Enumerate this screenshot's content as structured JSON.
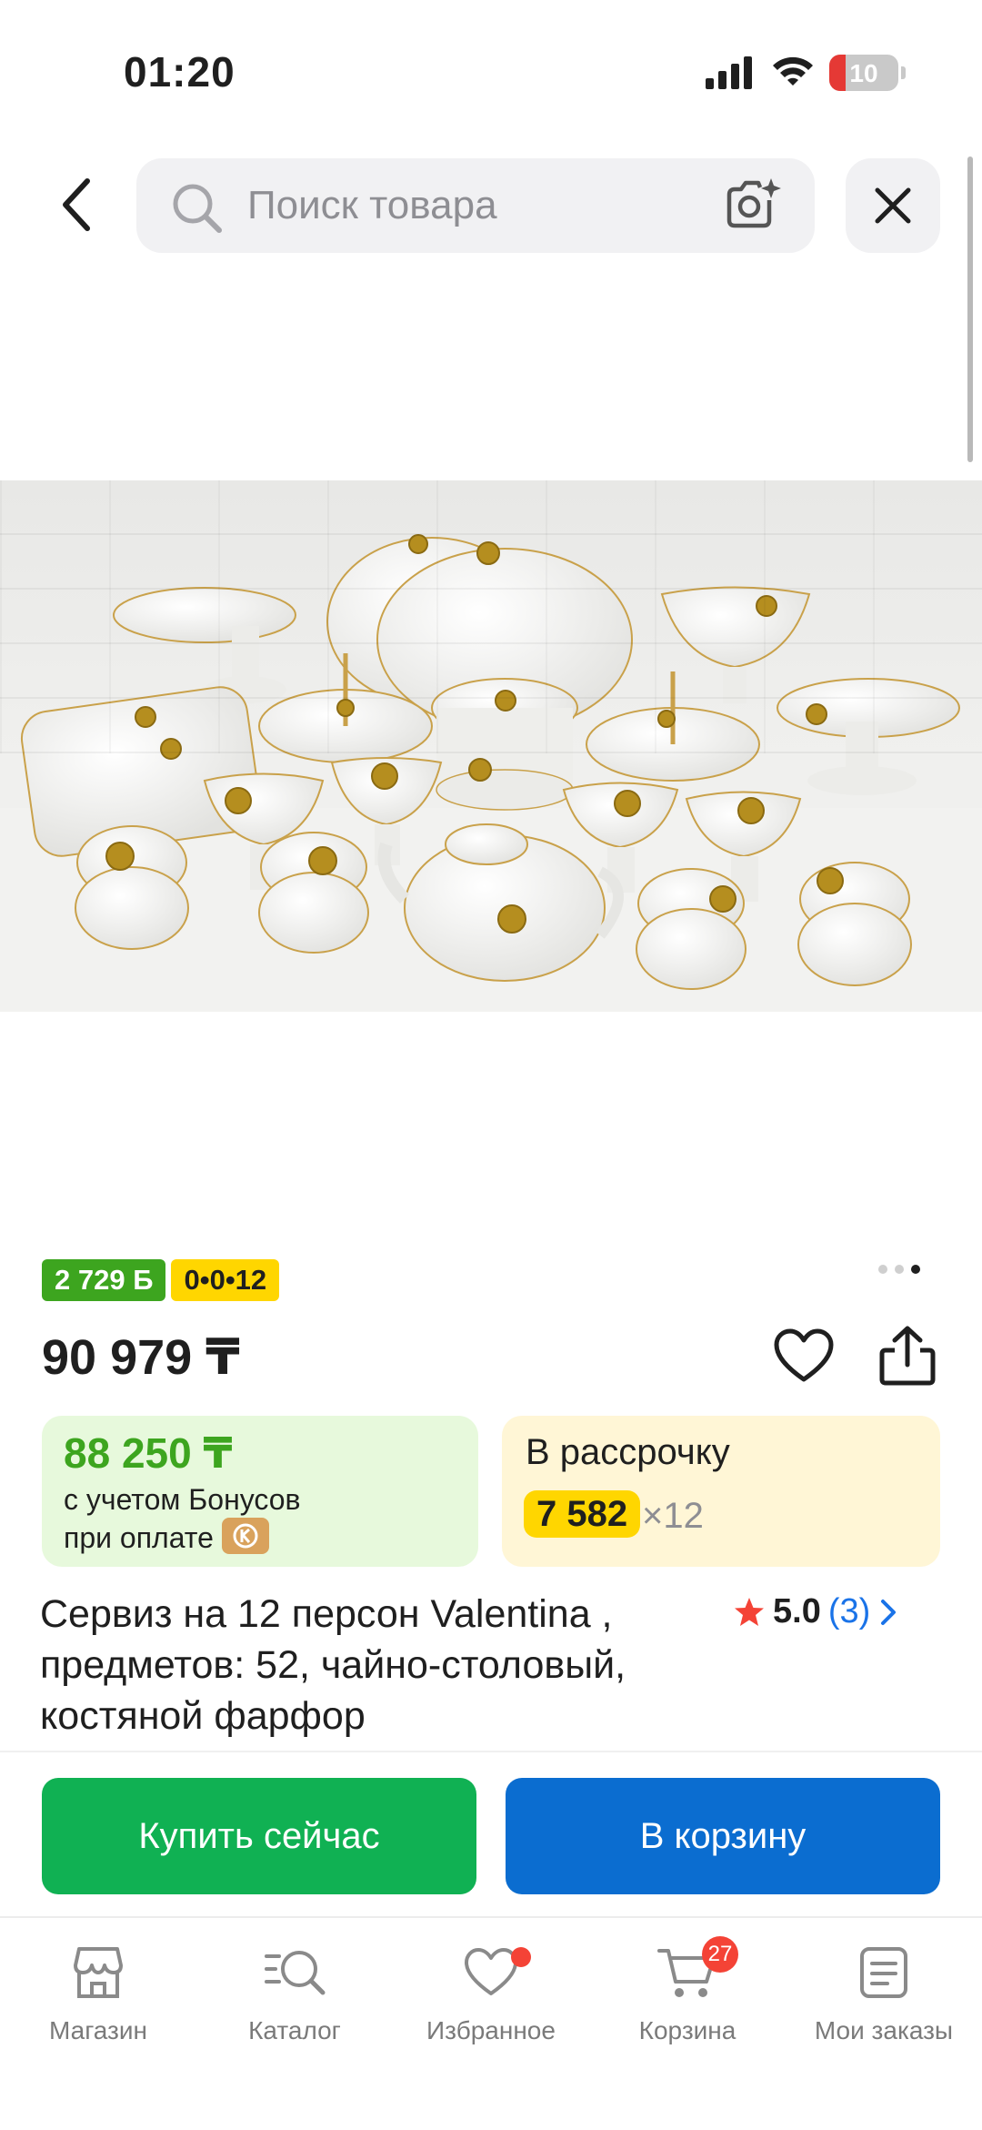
{
  "status_bar": {
    "time": "01:20",
    "battery": "10"
  },
  "search": {
    "placeholder": "Поиск товара"
  },
  "product": {
    "bonus_chip": "2 729 Б",
    "installment_chip": "0•0•12",
    "price": "90 979 ₸",
    "bonus_price": "88 250 ₸",
    "bonus_line1": "с учетом Бонусов",
    "bonus_line2": "при оплате",
    "installment_title": "В рассрочку",
    "installment_amount": "7 582",
    "installment_multiplier": "×12",
    "title": "Сервиз на 12 персон Valentina , предметов: 52, чайно-столовый, костяной фарфор",
    "rating": "5.0",
    "reviews": "(3)",
    "image_dots": {
      "count": 3,
      "active": 2
    }
  },
  "actions": {
    "buy_now": "Купить сейчас",
    "add_to_cart": "В корзину"
  },
  "bottom_nav": {
    "items": [
      {
        "label": "Магазин",
        "icon": "shop-icon"
      },
      {
        "label": "Каталог",
        "icon": "catalog-search-icon"
      },
      {
        "label": "Избранное",
        "icon": "heart-icon"
      },
      {
        "label": "Корзина",
        "icon": "cart-icon",
        "badge": "27"
      },
      {
        "label": "Мои заказы",
        "icon": "orders-icon"
      }
    ]
  },
  "colors": {
    "green": "#10b153",
    "blue": "#0b6dd0",
    "chip_green": "#3da51f",
    "chip_yellow": "#ffd600",
    "link": "#1a73e8",
    "badge": "#f44336"
  }
}
